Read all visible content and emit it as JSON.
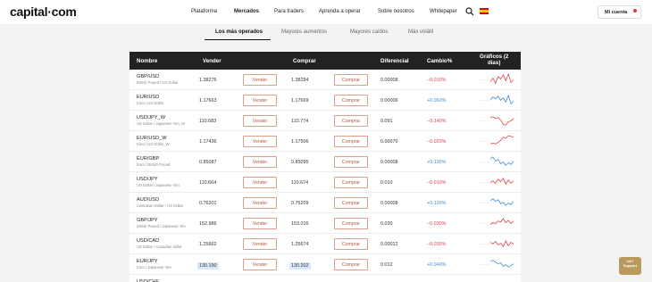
{
  "header": {
    "logo": "capital·com",
    "nav": [
      "Plataforma",
      "Mercados",
      "Para traders",
      "Aprenda a operar",
      "Sobre nosotros",
      "Whitepaper"
    ],
    "nav_active": "Mercados",
    "account_label": "Mi cuenta"
  },
  "tabs": [
    "Los más operados",
    "Mayores aumentos",
    "Mayores caídos",
    "Más volátil"
  ],
  "table": {
    "headers": {
      "name": "Nombre",
      "sell": "Vender",
      "buy": "Comprar",
      "spread": "Diferencial",
      "change": "Cambio%",
      "chart_line1": "Gráficos (2",
      "chart_line2": "días)"
    },
    "sell_label": "Vender",
    "buy_label": "Comprar",
    "rows": [
      {
        "pair": "GBP/USD",
        "desc": "British Pound / US Dollar",
        "sell": "1.38276",
        "buy": "1.38284",
        "spread": "0.00008",
        "change": "−0.010%",
        "dir": "neg",
        "spark": [
          6,
          10,
          4,
          12,
          9,
          14,
          7,
          15,
          5,
          8
        ]
      },
      {
        "pair": "EUR/USD",
        "desc": "Euro / US Dollar",
        "sell": "1.17663",
        "buy": "1.17669",
        "spread": "0.00006",
        "change": "+0.060%",
        "dir": "pos",
        "spark": [
          9,
          12,
          10,
          13,
          8,
          11,
          6,
          14,
          4,
          7
        ]
      },
      {
        "pair": "USD/JPY_W",
        "desc": "US Dollar / Japanese Yen_W",
        "sell": "110.683",
        "buy": "110.774",
        "spread": "0.091",
        "change": "−0.140%",
        "dir": "neg",
        "spark": [
          12,
          13,
          11,
          12,
          9,
          4,
          3,
          7,
          8,
          11
        ]
      },
      {
        "pair": "EUR/USD_W",
        "desc": "Euro / US Dollar_W",
        "sell": "1.17436",
        "buy": "1.17506",
        "spread": "0.00070",
        "change": "−0.020%",
        "dir": "neg",
        "spark": [
          5,
          6,
          5,
          7,
          9,
          13,
          12,
          15,
          14,
          13
        ]
      },
      {
        "pair": "EUR/GBP",
        "desc": "Euro / British Pound",
        "sell": "0.85087",
        "buy": "0.85095",
        "spread": "0.00008",
        "change": "+0.130%",
        "dir": "pos",
        "spark": [
          12,
          14,
          9,
          11,
          6,
          8,
          4,
          7,
          5,
          9
        ]
      },
      {
        "pair": "USD/JPY",
        "desc": "US Dollar / Japanese Yen",
        "sell": "110.664",
        "buy": "110.674",
        "spread": "0.010",
        "change": "−0.010%",
        "dir": "neg",
        "spark": [
          8,
          10,
          7,
          12,
          9,
          13,
          6,
          11,
          7,
          10
        ]
      },
      {
        "pair": "AUD/USD",
        "desc": "Australian Dollar / US Dollar",
        "sell": "0.76201",
        "buy": "0.76209",
        "spread": "0.00008",
        "change": "+0.100%",
        "dir": "pos",
        "spark": [
          11,
          13,
          10,
          12,
          7,
          9,
          5,
          8,
          6,
          10
        ]
      },
      {
        "pair": "GBP/JPY",
        "desc": "British Pound / Japanese Yen",
        "sell": "152.986",
        "buy": "153.016",
        "spread": "0.030",
        "change": "−0.030%",
        "dir": "neg",
        "spark": [
          7,
          9,
          8,
          11,
          10,
          14,
          9,
          12,
          8,
          11
        ]
      },
      {
        "pair": "USD/CAD",
        "desc": "US Dollar / Canadian dollar",
        "sell": "1.25662",
        "buy": "1.25674",
        "spread": "0.00012",
        "change": "−0.030%",
        "dir": "neg",
        "spark": [
          10,
          8,
          11,
          7,
          9,
          5,
          12,
          6,
          10,
          8
        ]
      },
      {
        "pair": "EUR/JPY",
        "desc": "Euro / Japanese Yen",
        "sell": "130.190",
        "buy": "130.202",
        "spread": "0.012",
        "change": "+0.040%",
        "dir": "pos",
        "spark": [
          12,
          13,
          11,
          9,
          10,
          6,
          8,
          5,
          7,
          9
        ],
        "highlight": true
      },
      {
        "pair": "USD/CHF",
        "desc": "",
        "sell": "",
        "buy": "",
        "spread": "",
        "change": "",
        "dir": "pos",
        "spark": []
      }
    ]
  },
  "support": {
    "line1": "24/7",
    "line2": "Support"
  },
  "colors": {
    "accent": "#b5573a",
    "positive": "#3b8fdc",
    "negative": "#e2434b",
    "header_bg": "#222222"
  },
  "icons": {
    "search": "search-icon",
    "flag": "spain-flag-icon"
  }
}
